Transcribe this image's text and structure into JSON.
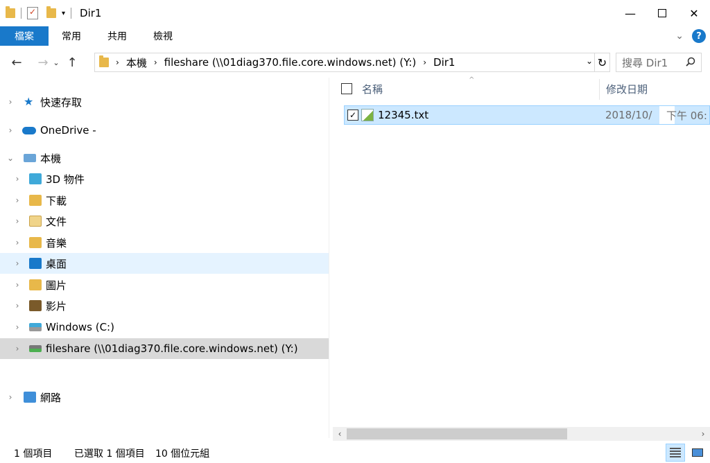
{
  "titlebar": {
    "title": "Dir1",
    "minimize_glyph": "—",
    "close_glyph": "✕"
  },
  "ribbon": {
    "tabs": [
      "檔案",
      "常用",
      "共用",
      "檢視"
    ],
    "help_label": "?"
  },
  "address": {
    "crumbs": [
      "本機",
      "fileshare (\\\\01diag370.file.core.windows.net) (Y:)",
      "Dir1"
    ]
  },
  "search": {
    "placeholder": "搜尋 Dir1"
  },
  "navpane": {
    "items": [
      {
        "label": "快速存取",
        "icon": "star-icon"
      },
      {
        "label": "OneDrive -",
        "icon": "cloud-icon"
      },
      {
        "label": "本機",
        "icon": "computer-icon"
      },
      {
        "label": "3D 物件",
        "icon": "3d-objects-icon"
      },
      {
        "label": "下載",
        "icon": "downloads-icon"
      },
      {
        "label": "文件",
        "icon": "documents-icon"
      },
      {
        "label": "音樂",
        "icon": "music-icon"
      },
      {
        "label": "桌面",
        "icon": "desktop-icon"
      },
      {
        "label": "圖片",
        "icon": "pictures-icon"
      },
      {
        "label": "影片",
        "icon": "videos-icon"
      },
      {
        "label": "Windows (C:)",
        "icon": "drive-icon"
      },
      {
        "label": "fileshare (\\\\01diag370.file.core.windows.net) (Y:)",
        "icon": "network-drive-icon"
      },
      {
        "label": "網路",
        "icon": "network-icon"
      }
    ]
  },
  "filelist": {
    "columns": [
      "名稱",
      "修改日期"
    ],
    "rows": [
      {
        "name": "12345.txt",
        "date": "2018/10/",
        "time": "下午 06:"
      }
    ]
  },
  "statusbar": {
    "item_count": "1 個項目",
    "selected": "已選取 1 個項目",
    "size": "10 個位元組"
  },
  "colors": {
    "accent": "#1979ca",
    "selection": "#cce8ff",
    "nav_selected": "#e5f3ff"
  }
}
